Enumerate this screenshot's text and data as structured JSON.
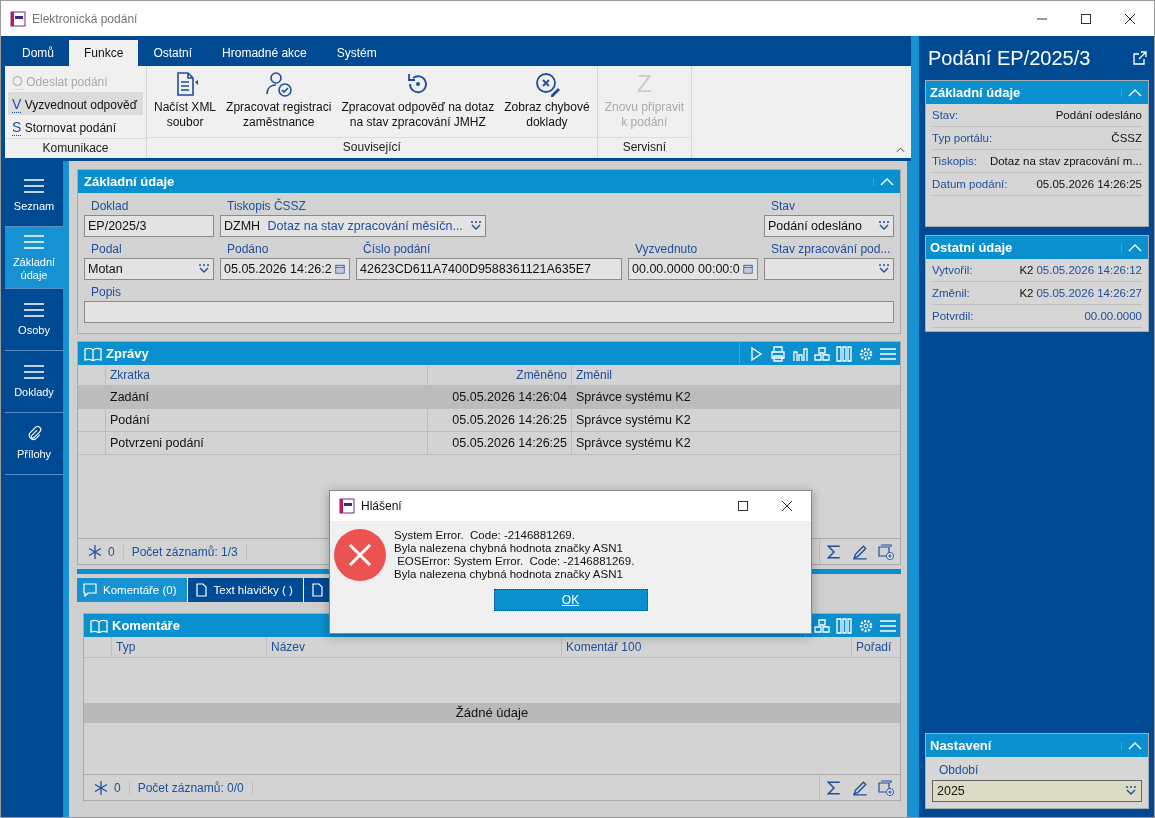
{
  "window": {
    "title": "Elektronická podání"
  },
  "ribbon": {
    "tabs": [
      {
        "label": "Domů",
        "selected": false
      },
      {
        "label": "Funkce",
        "selected": true
      },
      {
        "label": "Ostatní",
        "selected": false
      },
      {
        "label": "Hromadné akce",
        "selected": false
      },
      {
        "label": "Systém",
        "selected": false
      }
    ],
    "groups": [
      {
        "label": "Komunikace",
        "kind": "list",
        "items": [
          {
            "key": "O",
            "lines": [
              "Odeslat podání"
            ],
            "disabled": true,
            "highlighted": false
          },
          {
            "key": "V",
            "lines": [
              "Vyzvednout odpověď"
            ],
            "disabled": false,
            "highlighted": true
          },
          {
            "key": "S",
            "lines": [
              "Stornovat podání"
            ],
            "disabled": false,
            "highlighted": false
          }
        ]
      },
      {
        "label": "Související",
        "kind": "large",
        "items": [
          {
            "lines": [
              "Načíst XML",
              "soubor"
            ],
            "disabled": false
          },
          {
            "lines": [
              "Zpracovat registraci",
              "zaměstnance"
            ],
            "disabled": false
          },
          {
            "lines": [
              "Zpracovat odpověď na dotaz",
              "na stav zpracování JMHZ"
            ],
            "disabled": false
          },
          {
            "lines": [
              "Zobraz chybové",
              "doklady"
            ],
            "disabled": false
          }
        ]
      },
      {
        "label": "Servisní",
        "kind": "large",
        "items": [
          {
            "key": "Z",
            "lines": [
              "Znovu připravit",
              "k podání"
            ],
            "disabled": true
          }
        ]
      }
    ]
  },
  "nav": [
    {
      "label": "Seznam",
      "selected": false
    },
    {
      "label": "Základní údaje",
      "selected": true
    },
    {
      "label": "Osoby",
      "selected": false
    },
    {
      "label": "Doklady",
      "selected": false
    },
    {
      "label": "Přílohy",
      "selected": false
    }
  ],
  "basic": {
    "title": "Základní údaje",
    "fields": [
      {
        "label": "Doklad",
        "kind": "text",
        "value": "EP/2025/3"
      },
      {
        "label": "Tiskopis ČSSZ",
        "kind": "combo",
        "code": "DZMH",
        "value": "Dotaz na stav zpracování měsíčn..."
      },
      {
        "label": "Stav",
        "kind": "dropdown",
        "value": "Podání odesláno"
      },
      {
        "label": "Podal",
        "kind": "dropdown",
        "value": "Motan"
      },
      {
        "label": "Podáno",
        "kind": "date",
        "value": "05.05.2026 14:26:2"
      },
      {
        "label": "Číslo podání",
        "kind": "text",
        "value": "42623CD611A7400D9588361121A635E7"
      },
      {
        "label": "Vyzvednuto",
        "kind": "date",
        "value": "00.00.0000 00:00:0"
      },
      {
        "label": "Stav zpracování pod...",
        "kind": "dropdown"
      },
      {
        "label": "Popis",
        "kind": "text"
      }
    ]
  },
  "messages": {
    "title": "Zprávy",
    "columns": [
      "Zkratka",
      "Změněno",
      "Změnil"
    ],
    "rows": [
      {
        "cells": [
          "Zadání",
          "05.05.2026 14:26:04",
          "Správce systému K2"
        ],
        "selected": true
      },
      {
        "cells": [
          "Podání",
          "05.05.2026 14:26:25",
          "Správce systému K2"
        ],
        "selected": false
      },
      {
        "cells": [
          "Potvrzeni podání",
          "05.05.2026 14:26:25",
          "Správce systému K2"
        ],
        "selected": false
      }
    ],
    "footer": {
      "count": "0",
      "records": "Počet záznamů: 1/3"
    }
  },
  "bottom_tabs": [
    {
      "label": "Komentáře (0)",
      "selected": true
    },
    {
      "label": "Text hlavičky ( )",
      "selected": false
    },
    {
      "selected": false
    }
  ],
  "comments": {
    "title": "Komentáře",
    "columns": [
      "Typ",
      "Název",
      "Komentář 100",
      "Pořadí"
    ],
    "empty": "Žádné údaje",
    "footer": {
      "count": "0",
      "records": "Počet záznamů: 0/0"
    }
  },
  "side": {
    "title": "Podání EP/2025/3",
    "basic": {
      "title": "Základní údaje",
      "rows": [
        {
          "label": "Stav:",
          "value": "Podání odesláno"
        },
        {
          "label": "Typ portálu:",
          "value": "ČSSZ"
        },
        {
          "label": "Tiskopis:",
          "value": "Dotaz na stav zpracování m..."
        },
        {
          "label": "Datum podání:",
          "value": "05.05.2026 14:26:25"
        }
      ]
    },
    "other": {
      "title": "Ostatní údaje",
      "rows": [
        {
          "label": "Vytvořil:",
          "user": "K2",
          "value": "05.05.2026 14:26:12"
        },
        {
          "label": "Změnil:",
          "user": "K2",
          "value": "05.05.2026 14:26:27"
        },
        {
          "label": "Potvrdil:",
          "value": "00.00.0000"
        }
      ]
    },
    "settings": {
      "title": "Nastavení",
      "label": "Období",
      "value": "2025"
    }
  },
  "dialog": {
    "title": "Hlášení",
    "lines": [
      "System Error.  Code: -2146881269.",
      "Byla nalezena chybná hodnota značky ASN1",
      " EOSError: System Error.  Code: -2146881269.",
      "Byla nalezena chybná hodnota značky ASN1"
    ],
    "button": "OK"
  }
}
